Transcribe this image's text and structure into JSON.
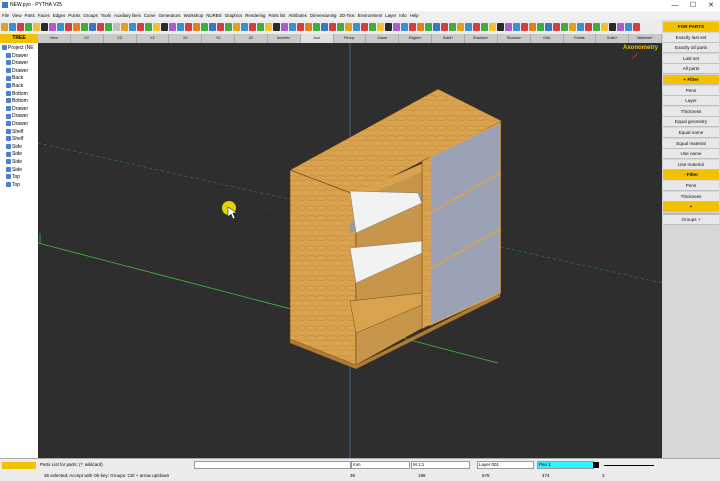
{
  "window": {
    "title": "NEW.pyo - PYTHA V25",
    "minimize": "—",
    "maximize": "☐",
    "close": "✕"
  },
  "menu": [
    "File",
    "View",
    "Parts",
    "Faces",
    "Edges",
    "Points",
    "Groups",
    "Tools",
    "Auxiliary lines",
    "Curve",
    "Generators",
    "Workshop",
    "NURBS",
    "Graphics",
    "Rendering",
    "Parts list",
    "Attributes",
    "Dimensioning",
    "2D-Text",
    "Environment",
    "Layer",
    "Info",
    "Help"
  ],
  "toolbar_colors": [
    "#e0a020",
    "#3a8fd0",
    "#d04040",
    "#3fae3f",
    "#f0c030",
    "#2a2a2a",
    "#b05ad0",
    "#3a8fd0",
    "#d04040",
    "#e08020",
    "#3fae3f",
    "#3a77c9",
    "#d04040",
    "#3fae3f",
    "#c0c0c0",
    "#e0a020",
    "#3a8fd0",
    "#d04040",
    "#3fae3f",
    "#f0c030",
    "#2a2a2a",
    "#b05ad0",
    "#3a8fd0",
    "#d04040",
    "#e08020",
    "#3fae3f",
    "#3a77c9",
    "#d04040",
    "#3fae3f",
    "#e0a020",
    "#3a8fd0",
    "#d04040",
    "#3fae3f",
    "#f0c030",
    "#2a2a2a",
    "#b05ad0",
    "#3a8fd0",
    "#d04040",
    "#e08020",
    "#3fae3f",
    "#3a77c9",
    "#d04040",
    "#3fae3f",
    "#e0a020",
    "#3a8fd0",
    "#d04040",
    "#3fae3f",
    "#f0c030",
    "#2a2a2a",
    "#b05ad0",
    "#3a8fd0",
    "#d04040",
    "#e08020",
    "#3fae3f",
    "#3a77c9",
    "#d04040",
    "#3fae3f",
    "#e0a020",
    "#3a8fd0",
    "#d04040",
    "#3fae3f",
    "#f0c030",
    "#2a2a2a",
    "#b05ad0",
    "#3a8fd0",
    "#d04040",
    "#e08020",
    "#3fae3f",
    "#3a77c9",
    "#d04040",
    "#3fae3f",
    "#e0a020",
    "#3a8fd0",
    "#d04040",
    "#3fae3f",
    "#f0c030",
    "#2a2a2a",
    "#b05ad0",
    "#3a8fd0",
    "#d04040"
  ],
  "views": [
    "View",
    "XY",
    "XZ",
    "YZ",
    "X2",
    "Y2",
    "Z2",
    "Isometr.",
    "Axo",
    "Persp.",
    "Zoom",
    "Edges+",
    "Solid+",
    "Shadow+",
    "Shadow",
    "Grid",
    "Points",
    "Solid+",
    "Material+"
  ],
  "active_view_index": 8,
  "tree": {
    "header": "TREE",
    "items": [
      "Project (NE",
      "Drawer",
      "Drawer",
      "Drawer",
      "Back",
      "Back",
      "Bottom",
      "Bottom",
      "Drawer",
      "Drawer",
      "Drawer",
      "Shelf",
      "Shelf",
      "Side",
      "Side",
      "Side",
      "Side",
      "Top",
      "Top"
    ]
  },
  "viewport": {
    "label": "Axonometry"
  },
  "right_panel": {
    "items": [
      {
        "label": "FOR PARTS",
        "kind": "hdr"
      },
      {
        "label": "Exactly last set",
        "kind": "btn"
      },
      {
        "label": "Exactly all parts",
        "kind": "btn"
      },
      {
        "label": "Last set",
        "kind": "btn"
      },
      {
        "label": "All parts",
        "kind": "btn"
      },
      {
        "label": "+ Filter",
        "kind": "hdr"
      },
      {
        "label": "Pens",
        "kind": "btn"
      },
      {
        "label": "Layer",
        "kind": "btn"
      },
      {
        "label": "Thickness",
        "kind": "btn"
      },
      {
        "label": "Equal geometry",
        "kind": "btn"
      },
      {
        "label": "Equal name",
        "kind": "btn"
      },
      {
        "label": "Equal material",
        "kind": "btn"
      },
      {
        "label": "Use name",
        "kind": "btn"
      },
      {
        "label": "Use material",
        "kind": "btn"
      },
      {
        "label": "- Filter",
        "kind": "hdr"
      },
      {
        "label": "Pens",
        "kind": "btn"
      },
      {
        "label": "Thickness",
        "kind": "btn"
      },
      {
        "label": "+",
        "kind": "hdr"
      },
      {
        "label": "",
        "kind": "sep"
      },
      {
        "label": "Groups +",
        "kind": "btn"
      }
    ]
  },
  "status": {
    "prompt": "Parts List for parts: (*: wildcard)",
    "hint": "36 selected; Accept with Ok-key; Groups: Ctrl + arrow up/down",
    "unit": "mm",
    "scale": "M 1:1",
    "layer": "Layer 001",
    "pen": "Pen 1",
    "coord_a": "36",
    "coord_b": "198",
    "coord_c": "576",
    "coord_d": "474",
    "coord_e": "3"
  }
}
